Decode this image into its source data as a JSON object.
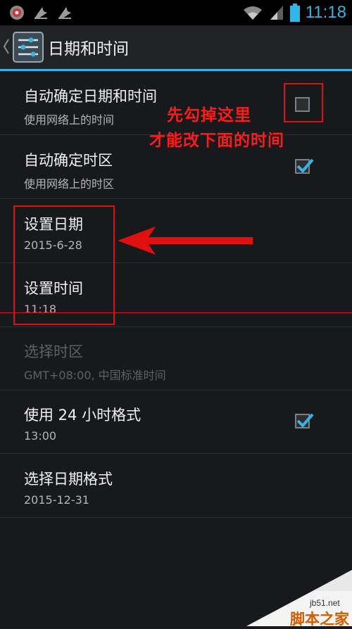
{
  "status_bar": {
    "time": "11:18",
    "icons": [
      "screen-recorder-icon",
      "notification-icon",
      "notification-icon",
      "wifi-icon",
      "signal-icon",
      "battery-icon"
    ]
  },
  "action_bar": {
    "title": "日期和时间"
  },
  "settings": [
    {
      "title": "自动确定日期和时间",
      "summary": "使用网络上的时间",
      "checkbox": "unchecked"
    },
    {
      "title": "自动确定时区",
      "summary": "使用网络上的时区",
      "checkbox": "checked"
    },
    {
      "title": "设置日期",
      "summary": "2015-6-28"
    },
    {
      "title": "设置时间",
      "summary": "11:18"
    },
    {
      "title": "选择时区",
      "summary": "GMT+08:00, 中国标准时间",
      "disabled": true
    },
    {
      "title": "使用 24 小时格式",
      "summary": "13:00",
      "checkbox": "checked"
    },
    {
      "title": "选择日期格式",
      "summary": "2015-12-31"
    }
  ],
  "annotations": {
    "note_line1": "先勾掉这里",
    "note_line2": "才能改下面的时间",
    "color": "#e01010"
  },
  "watermark": {
    "url": "jb51.net",
    "text": "脚本之家"
  },
  "colors": {
    "accent": "#33b5e5",
    "background": "#17191c"
  }
}
